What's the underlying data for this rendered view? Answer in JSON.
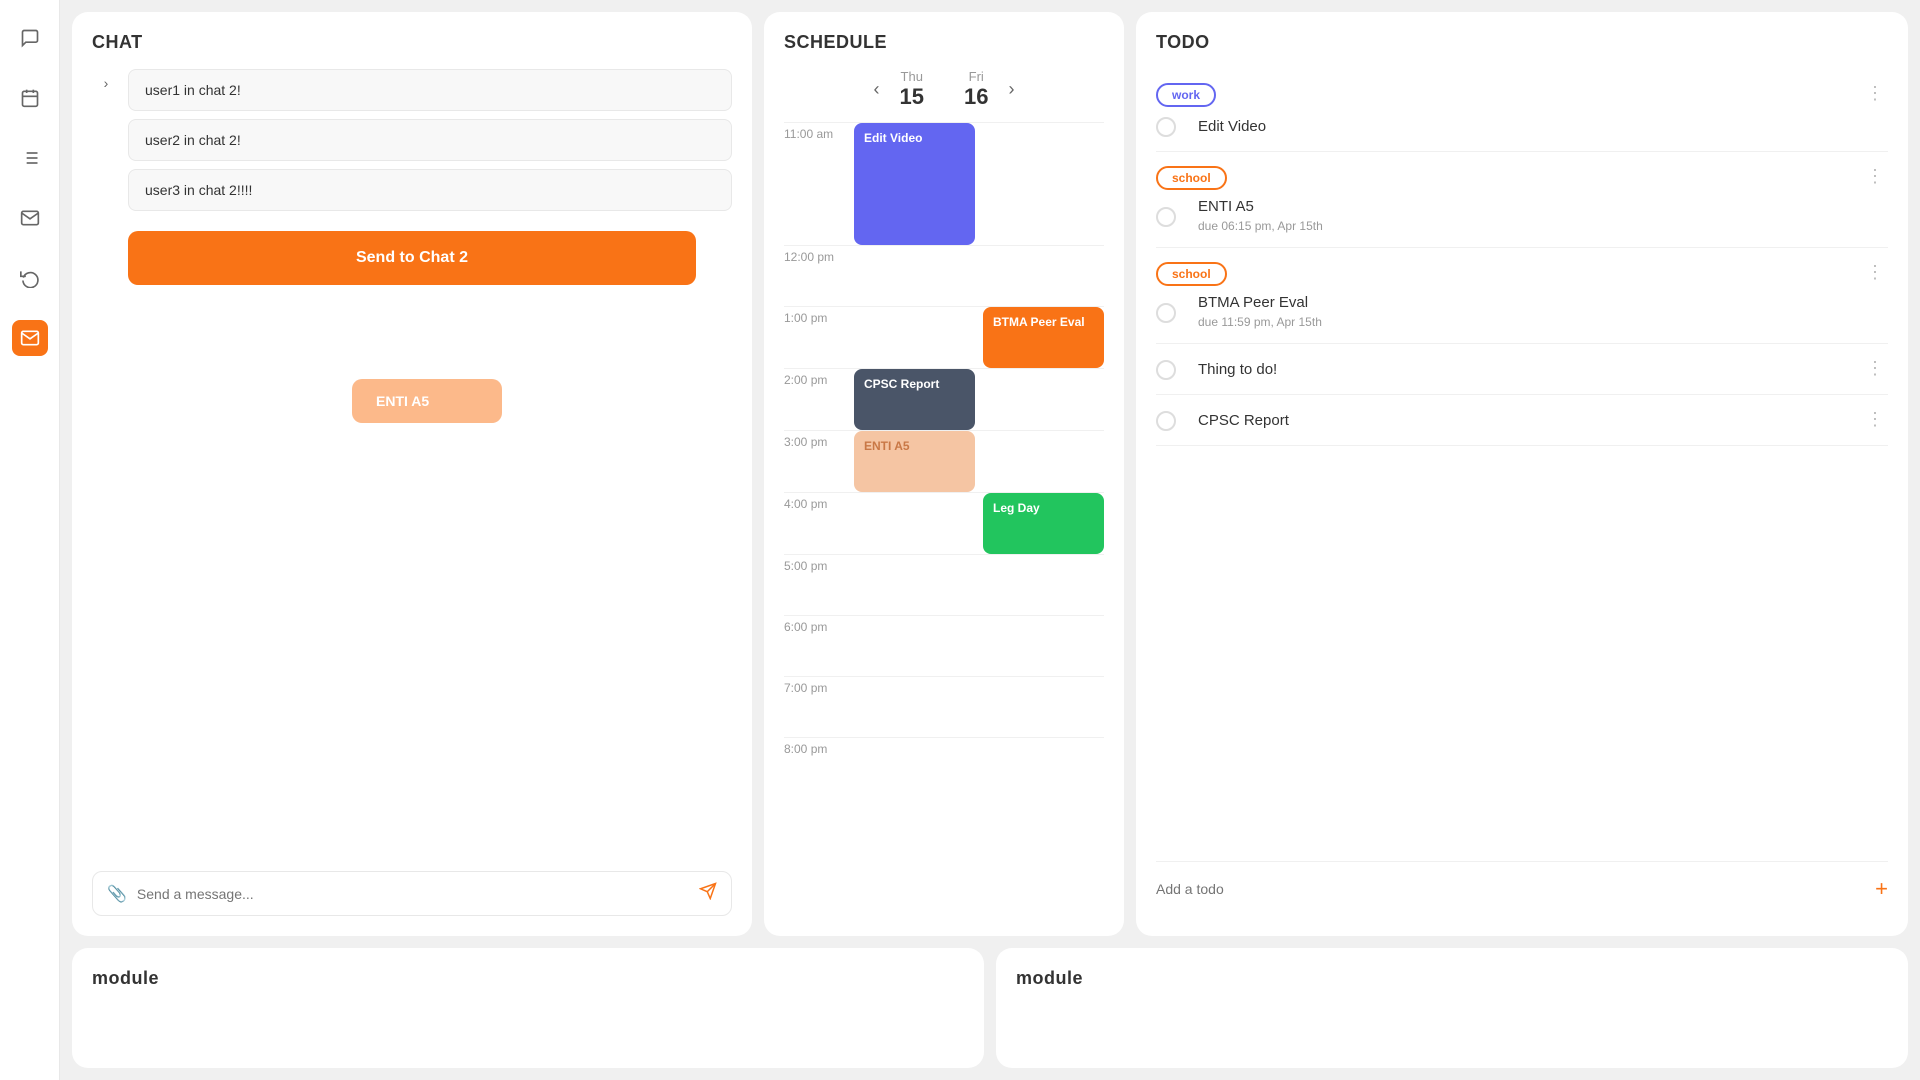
{
  "sidebar": {
    "icons": [
      {
        "name": "chat-icon",
        "symbol": "💬",
        "active": false
      },
      {
        "name": "calendar-icon",
        "symbol": "📅",
        "active": false
      },
      {
        "name": "list-icon",
        "symbol": "☰",
        "active": false
      },
      {
        "name": "mail-icon",
        "symbol": "✉",
        "active": false
      },
      {
        "name": "refresh-icon",
        "symbol": "↺",
        "active": false
      },
      {
        "name": "mail2-icon",
        "symbol": "✉",
        "active": true
      }
    ]
  },
  "chat": {
    "title": "CHAT",
    "messages": [
      {
        "text": "user1 in chat 2!"
      },
      {
        "text": "user2 in chat 2!"
      },
      {
        "text": "user3 in chat 2!!!!"
      }
    ],
    "send_button": "Send to Chat 2",
    "dragged_item": "ENTI A5",
    "input_placeholder": "Send a message..."
  },
  "schedule": {
    "title": "SCHEDULE",
    "prev_label": "‹",
    "next_label": "›",
    "days": [
      {
        "name": "Thu",
        "num": "15"
      },
      {
        "name": "Fri",
        "num": "16"
      }
    ],
    "time_slots": [
      {
        "time": "11:00 am",
        "thu": {
          "label": "Edit Video",
          "color": "purple",
          "span": 2
        },
        "fri": null
      },
      {
        "time": "12:00 pm",
        "thu": null,
        "fri": null
      },
      {
        "time": "1:00 pm",
        "thu": null,
        "fri": {
          "label": "BTMA Peer Eval",
          "color": "orange",
          "span": 1
        }
      },
      {
        "time": "2:00 pm",
        "thu": {
          "label": "CPSC Report",
          "color": "dark",
          "span": 1
        },
        "fri": null
      },
      {
        "time": "3:00 pm",
        "thu": {
          "label": "ENTI A5",
          "color": "peach",
          "span": 1
        },
        "fri": null
      },
      {
        "time": "4:00 pm",
        "thu": null,
        "fri": {
          "label": "Leg Day",
          "color": "green",
          "span": 1
        }
      },
      {
        "time": "5:00 pm",
        "thu": null,
        "fri": null
      },
      {
        "time": "6:00 pm",
        "thu": null,
        "fri": null
      },
      {
        "time": "7:00 pm",
        "thu": null,
        "fri": null
      },
      {
        "time": "8:00 pm",
        "thu": null,
        "fri": null
      }
    ]
  },
  "todo": {
    "title": "TODO",
    "items": [
      {
        "tag": "work",
        "tag_class": "work",
        "title": "Edit Video",
        "due": null,
        "checked": false
      },
      {
        "tag": "school",
        "tag_class": "school",
        "title": "ENTI A5",
        "due": "due 06:15 pm, Apr 15th",
        "checked": false
      },
      {
        "tag": "school",
        "tag_class": "school",
        "title": "BTMA Peer Eval",
        "due": "due 11:59 pm, Apr 15th",
        "checked": false
      },
      {
        "tag": null,
        "title": "Thing to do!",
        "due": null,
        "checked": false
      },
      {
        "tag": null,
        "title": "CPSC Report",
        "due": null,
        "checked": false
      }
    ],
    "add_placeholder": "Add a todo",
    "add_btn": "+"
  },
  "modules": [
    {
      "title": "module"
    },
    {
      "title": "module"
    }
  ]
}
